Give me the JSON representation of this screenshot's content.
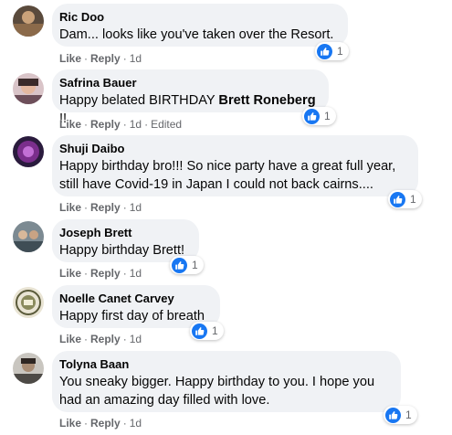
{
  "comments": [
    {
      "name": "Ric Doo",
      "line1": "Dam... looks like you've taken over the Resort.",
      "reactions": "1",
      "like": "Like",
      "reply": "Reply",
      "dot": "·",
      "time": "1d",
      "edited": ""
    },
    {
      "name": "Safrina Bauer",
      "text_before": "Happy belated BIRTHDAY ",
      "mention": "Brett Roneberg",
      "text_after": " !!",
      "reactions": "1",
      "like": "Like",
      "reply": "Reply",
      "dot": "·",
      "time": "1d",
      "edited": "Edited"
    },
    {
      "name": "Shuji Daibo",
      "line1": "Happy birthday bro!!! So nice party have a great full year,",
      "line2": "still have Covid-19 in Japan I could not back cairns....",
      "reactions": "1",
      "like": "Like",
      "reply": "Reply",
      "dot": "·",
      "time": "1d"
    },
    {
      "name": "Joseph Brett",
      "line1": "Happy birthday Brett!",
      "reactions": "1",
      "like": "Like",
      "reply": "Reply",
      "dot": "·",
      "time": "1d"
    },
    {
      "name": "Noelle Canet Carvey",
      "line1": "Happy first day of breath",
      "reactions": "1",
      "like": "Like",
      "reply": "Reply",
      "dot": "·",
      "time": "1d"
    },
    {
      "name": "Tolyna Baan",
      "line1": "You sneaky bigger. Happy birthday to you. I hope you",
      "line2": "had an amazing day filled with love.",
      "reactions": "1",
      "like": "Like",
      "reply": "Reply",
      "dot": "·",
      "time": "1d"
    }
  ],
  "colors": {
    "like_blue": "#1877f2",
    "bubble": "#f0f2f5",
    "meta": "#65676b"
  }
}
